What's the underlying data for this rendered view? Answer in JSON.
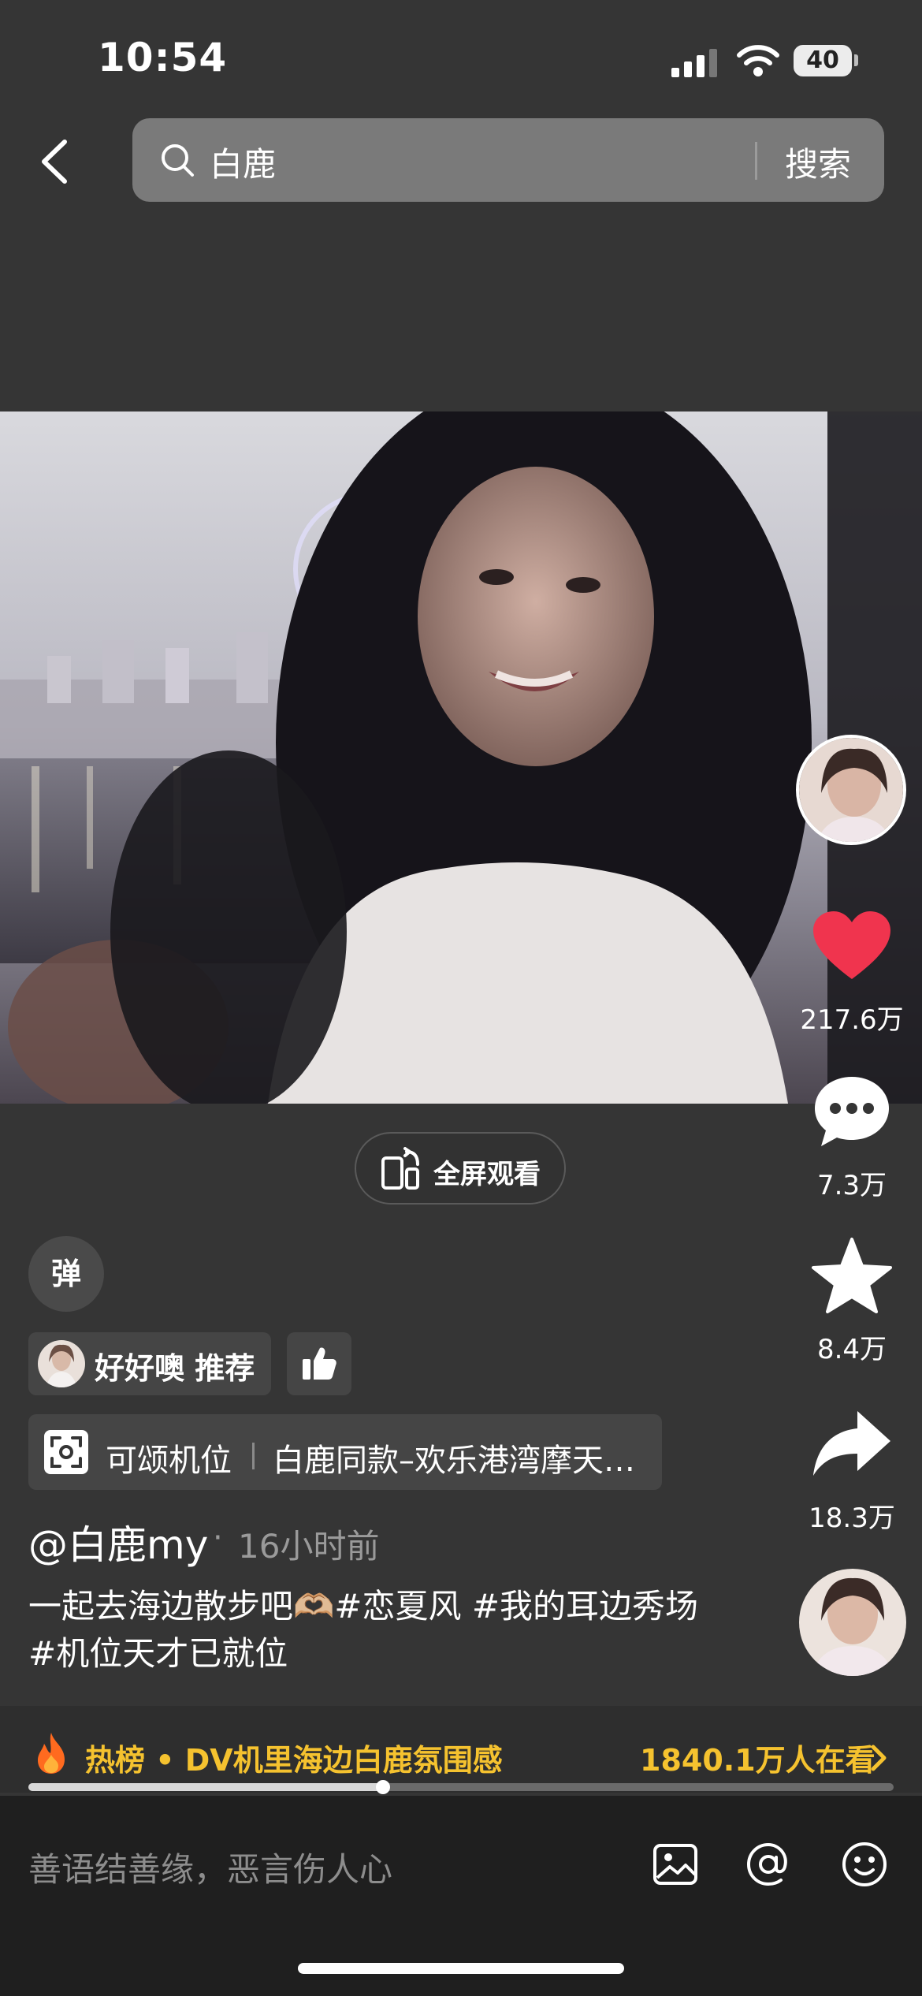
{
  "status_bar": {
    "time": "10:54",
    "battery": "40"
  },
  "search": {
    "query": "白鹿",
    "button_label": "搜索"
  },
  "video": {
    "fullscreen_label": "全屏观看"
  },
  "rail": {
    "likes": "217.6万",
    "comments": "7.3万",
    "favorites": "8.4万",
    "shares": "18.3万"
  },
  "danmu_label": "弹",
  "recommend": {
    "label": "好好噢 推荐"
  },
  "camera_position": {
    "label": "可颂机位",
    "text": "白鹿同款–欢乐港湾摩天…"
  },
  "post": {
    "author": "@白鹿my",
    "separator": "·",
    "time": "16小时前",
    "description": "一起去海边散步吧🫶🏼#恋夏风 #我的耳边秀场 #机位天才已就位"
  },
  "hot": {
    "title": "热榜 • DV机里海边白鹿氛围感",
    "viewers": "1840.1万人在看",
    "progress": 0.41
  },
  "comment": {
    "placeholder": "善语结善缘，恶言伤人心"
  },
  "colors": {
    "like": "#f0344e",
    "hot": "#f5c22f"
  }
}
